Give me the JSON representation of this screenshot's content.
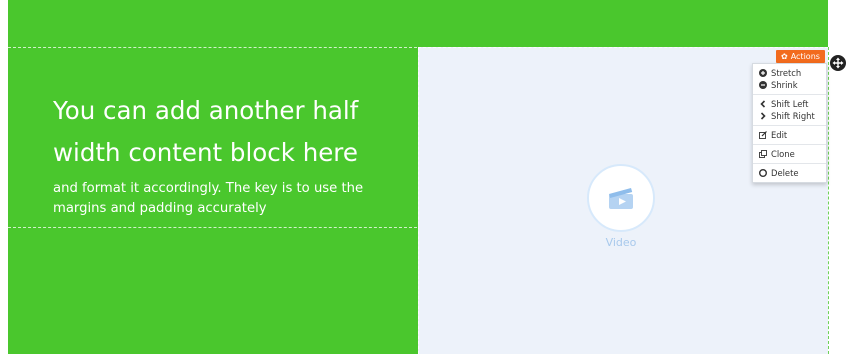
{
  "content": {
    "headline": "You can add another half width content block here",
    "body": "and format it accordingly. The key is to use the margins and padding accurately"
  },
  "video": {
    "label": "Video",
    "icon": "video-clapper-icon"
  },
  "actions": {
    "button_label": "Actions",
    "menu": {
      "stretch": "Stretch",
      "shrink": "Shrink",
      "shift_left": "Shift Left",
      "shift_right": "Shift Right",
      "edit": "Edit",
      "clone": "Clone",
      "delete": "Delete"
    }
  },
  "colors": {
    "background_green": "#4ac72d",
    "actions_orange": "#f26b1d",
    "video_panel": "#edf2fa",
    "video_accent": "#a8c9ec"
  }
}
